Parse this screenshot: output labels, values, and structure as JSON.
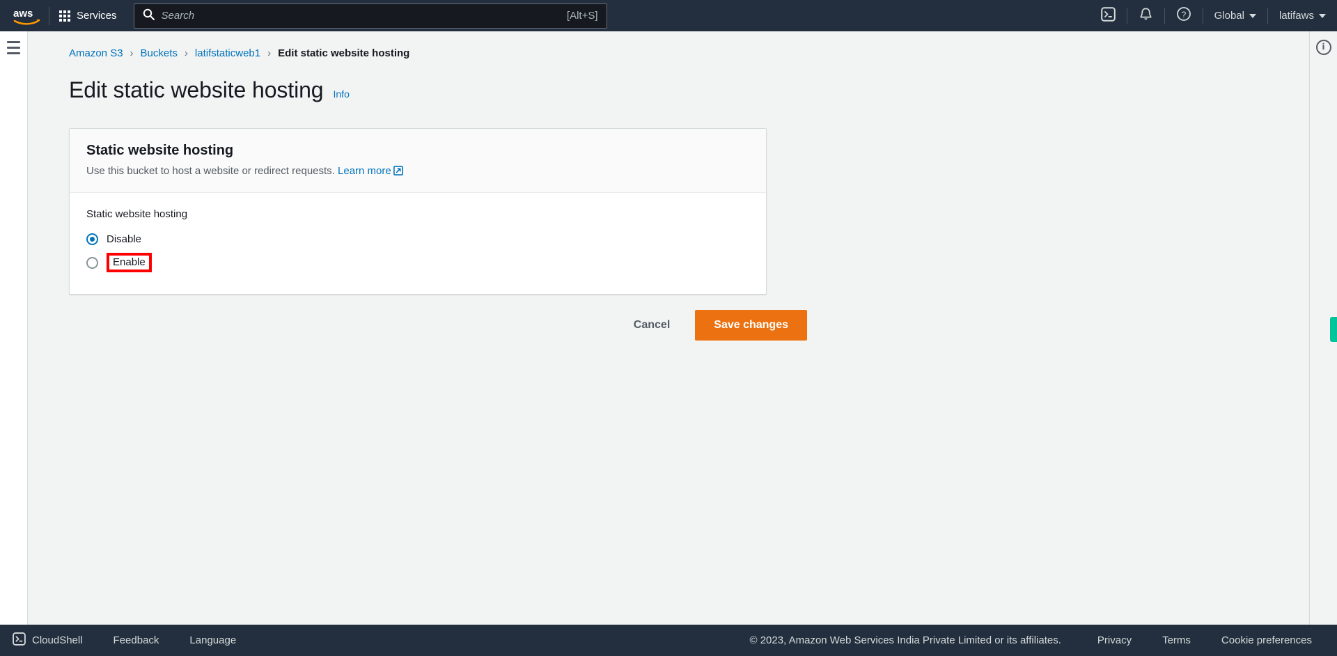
{
  "topnav": {
    "logo_alt": "aws",
    "services_label": "Services",
    "search": {
      "placeholder": "Search",
      "value": "",
      "shortcut": "[Alt+S]"
    },
    "cloudshell_icon": "cloudshell-icon",
    "notifications_icon": "bell-icon",
    "help_icon": "help-circle-icon",
    "region_label": "Global",
    "account_label": "latifaws"
  },
  "leftrail": {
    "menu_icon": "hamburger-menu-icon"
  },
  "rightrail": {
    "info_icon": "info-circle-icon",
    "feedback_tab": "feedback-tab"
  },
  "breadcrumb": {
    "items": [
      {
        "label": "Amazon S3",
        "link": true
      },
      {
        "label": "Buckets",
        "link": true
      },
      {
        "label": "latifstaticweb1",
        "link": true
      },
      {
        "label": "Edit static website hosting",
        "link": false
      }
    ],
    "separator": "›"
  },
  "page": {
    "title": "Edit static website hosting",
    "info_label": "Info"
  },
  "card": {
    "title": "Static website hosting",
    "description_text": "Use this bucket to host a website or redirect requests.",
    "learn_more_label": "Learn more",
    "field_label": "Static website hosting",
    "options": [
      {
        "label": "Disable",
        "selected": true,
        "annotated": false
      },
      {
        "label": "Enable",
        "selected": false,
        "annotated": true
      }
    ],
    "annotation_color": "#ff0000"
  },
  "actions": {
    "cancel_label": "Cancel",
    "save_label": "Save changes",
    "primary_color": "#ec7211"
  },
  "footer": {
    "cloudshell_label": "CloudShell",
    "feedback_label": "Feedback",
    "language_label": "Language",
    "copyright": "© 2023, Amazon Web Services India Private Limited or its affiliates.",
    "privacy_label": "Privacy",
    "terms_label": "Terms",
    "cookie_label": "Cookie preferences"
  },
  "colors": {
    "nav_background": "#232f3e",
    "page_background": "#f2f3f3",
    "link": "#0073bb",
    "accent_orange": "#ec7211",
    "feedback_teal": "#00c49a"
  }
}
